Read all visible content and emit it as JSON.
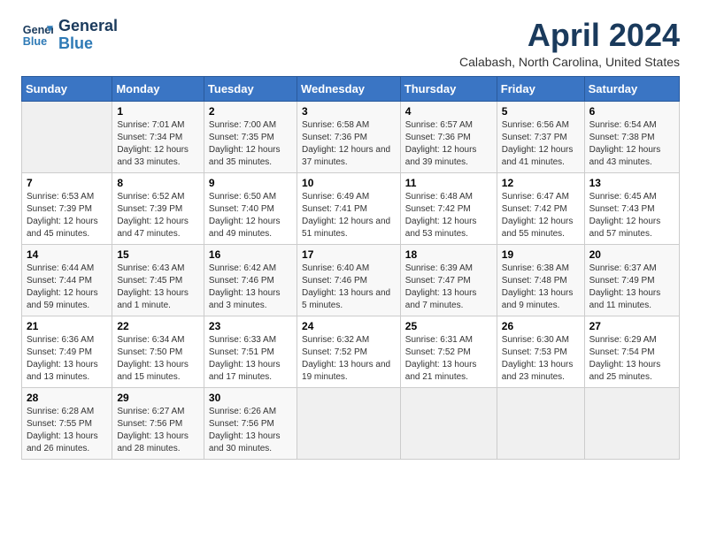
{
  "header": {
    "logo_line1": "General",
    "logo_line2": "Blue",
    "title": "April 2024",
    "subtitle": "Calabash, North Carolina, United States"
  },
  "days_of_week": [
    "Sunday",
    "Monday",
    "Tuesday",
    "Wednesday",
    "Thursday",
    "Friday",
    "Saturday"
  ],
  "weeks": [
    [
      {
        "day": "",
        "sunrise": "",
        "sunset": "",
        "daylight": "",
        "empty": true
      },
      {
        "day": "1",
        "sunrise": "Sunrise: 7:01 AM",
        "sunset": "Sunset: 7:34 PM",
        "daylight": "Daylight: 12 hours and 33 minutes."
      },
      {
        "day": "2",
        "sunrise": "Sunrise: 7:00 AM",
        "sunset": "Sunset: 7:35 PM",
        "daylight": "Daylight: 12 hours and 35 minutes."
      },
      {
        "day": "3",
        "sunrise": "Sunrise: 6:58 AM",
        "sunset": "Sunset: 7:36 PM",
        "daylight": "Daylight: 12 hours and 37 minutes."
      },
      {
        "day": "4",
        "sunrise": "Sunrise: 6:57 AM",
        "sunset": "Sunset: 7:36 PM",
        "daylight": "Daylight: 12 hours and 39 minutes."
      },
      {
        "day": "5",
        "sunrise": "Sunrise: 6:56 AM",
        "sunset": "Sunset: 7:37 PM",
        "daylight": "Daylight: 12 hours and 41 minutes."
      },
      {
        "day": "6",
        "sunrise": "Sunrise: 6:54 AM",
        "sunset": "Sunset: 7:38 PM",
        "daylight": "Daylight: 12 hours and 43 minutes."
      }
    ],
    [
      {
        "day": "7",
        "sunrise": "Sunrise: 6:53 AM",
        "sunset": "Sunset: 7:39 PM",
        "daylight": "Daylight: 12 hours and 45 minutes."
      },
      {
        "day": "8",
        "sunrise": "Sunrise: 6:52 AM",
        "sunset": "Sunset: 7:39 PM",
        "daylight": "Daylight: 12 hours and 47 minutes."
      },
      {
        "day": "9",
        "sunrise": "Sunrise: 6:50 AM",
        "sunset": "Sunset: 7:40 PM",
        "daylight": "Daylight: 12 hours and 49 minutes."
      },
      {
        "day": "10",
        "sunrise": "Sunrise: 6:49 AM",
        "sunset": "Sunset: 7:41 PM",
        "daylight": "Daylight: 12 hours and 51 minutes."
      },
      {
        "day": "11",
        "sunrise": "Sunrise: 6:48 AM",
        "sunset": "Sunset: 7:42 PM",
        "daylight": "Daylight: 12 hours and 53 minutes."
      },
      {
        "day": "12",
        "sunrise": "Sunrise: 6:47 AM",
        "sunset": "Sunset: 7:42 PM",
        "daylight": "Daylight: 12 hours and 55 minutes."
      },
      {
        "day": "13",
        "sunrise": "Sunrise: 6:45 AM",
        "sunset": "Sunset: 7:43 PM",
        "daylight": "Daylight: 12 hours and 57 minutes."
      }
    ],
    [
      {
        "day": "14",
        "sunrise": "Sunrise: 6:44 AM",
        "sunset": "Sunset: 7:44 PM",
        "daylight": "Daylight: 12 hours and 59 minutes."
      },
      {
        "day": "15",
        "sunrise": "Sunrise: 6:43 AM",
        "sunset": "Sunset: 7:45 PM",
        "daylight": "Daylight: 13 hours and 1 minute."
      },
      {
        "day": "16",
        "sunrise": "Sunrise: 6:42 AM",
        "sunset": "Sunset: 7:46 PM",
        "daylight": "Daylight: 13 hours and 3 minutes."
      },
      {
        "day": "17",
        "sunrise": "Sunrise: 6:40 AM",
        "sunset": "Sunset: 7:46 PM",
        "daylight": "Daylight: 13 hours and 5 minutes."
      },
      {
        "day": "18",
        "sunrise": "Sunrise: 6:39 AM",
        "sunset": "Sunset: 7:47 PM",
        "daylight": "Daylight: 13 hours and 7 minutes."
      },
      {
        "day": "19",
        "sunrise": "Sunrise: 6:38 AM",
        "sunset": "Sunset: 7:48 PM",
        "daylight": "Daylight: 13 hours and 9 minutes."
      },
      {
        "day": "20",
        "sunrise": "Sunrise: 6:37 AM",
        "sunset": "Sunset: 7:49 PM",
        "daylight": "Daylight: 13 hours and 11 minutes."
      }
    ],
    [
      {
        "day": "21",
        "sunrise": "Sunrise: 6:36 AM",
        "sunset": "Sunset: 7:49 PM",
        "daylight": "Daylight: 13 hours and 13 minutes."
      },
      {
        "day": "22",
        "sunrise": "Sunrise: 6:34 AM",
        "sunset": "Sunset: 7:50 PM",
        "daylight": "Daylight: 13 hours and 15 minutes."
      },
      {
        "day": "23",
        "sunrise": "Sunrise: 6:33 AM",
        "sunset": "Sunset: 7:51 PM",
        "daylight": "Daylight: 13 hours and 17 minutes."
      },
      {
        "day": "24",
        "sunrise": "Sunrise: 6:32 AM",
        "sunset": "Sunset: 7:52 PM",
        "daylight": "Daylight: 13 hours and 19 minutes."
      },
      {
        "day": "25",
        "sunrise": "Sunrise: 6:31 AM",
        "sunset": "Sunset: 7:52 PM",
        "daylight": "Daylight: 13 hours and 21 minutes."
      },
      {
        "day": "26",
        "sunrise": "Sunrise: 6:30 AM",
        "sunset": "Sunset: 7:53 PM",
        "daylight": "Daylight: 13 hours and 23 minutes."
      },
      {
        "day": "27",
        "sunrise": "Sunrise: 6:29 AM",
        "sunset": "Sunset: 7:54 PM",
        "daylight": "Daylight: 13 hours and 25 minutes."
      }
    ],
    [
      {
        "day": "28",
        "sunrise": "Sunrise: 6:28 AM",
        "sunset": "Sunset: 7:55 PM",
        "daylight": "Daylight: 13 hours and 26 minutes."
      },
      {
        "day": "29",
        "sunrise": "Sunrise: 6:27 AM",
        "sunset": "Sunset: 7:56 PM",
        "daylight": "Daylight: 13 hours and 28 minutes."
      },
      {
        "day": "30",
        "sunrise": "Sunrise: 6:26 AM",
        "sunset": "Sunset: 7:56 PM",
        "daylight": "Daylight: 13 hours and 30 minutes."
      },
      {
        "day": "",
        "sunrise": "",
        "sunset": "",
        "daylight": "",
        "empty": true
      },
      {
        "day": "",
        "sunrise": "",
        "sunset": "",
        "daylight": "",
        "empty": true
      },
      {
        "day": "",
        "sunrise": "",
        "sunset": "",
        "daylight": "",
        "empty": true
      },
      {
        "day": "",
        "sunrise": "",
        "sunset": "",
        "daylight": "",
        "empty": true
      }
    ]
  ]
}
